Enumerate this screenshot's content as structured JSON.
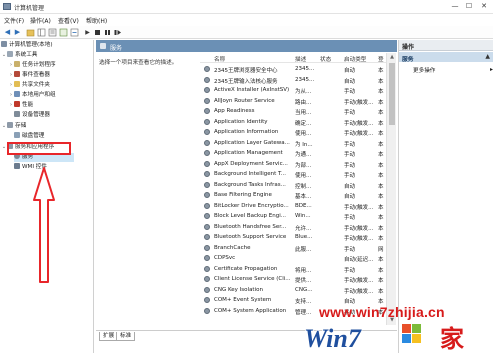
{
  "window": {
    "title": "计算机管理",
    "minimize": "—",
    "maximize": "☐",
    "close": "✕"
  },
  "menu": [
    "文件(F)",
    "操作(A)",
    "查看(V)",
    "帮助(H)"
  ],
  "tree": {
    "root": "计算机管理(本地)",
    "system_tools": "系统工具",
    "task_scheduler": "任务计划程序",
    "event_viewer": "事件查看器",
    "shared_folders": "共享文件夹",
    "local_users": "本地用户和组",
    "performance": "性能",
    "device_manager": "设备管理器",
    "storage": "存储",
    "disk_management": "磁盘管理",
    "services_apps": "服务和应用程序",
    "services": "服务",
    "wmi": "WMI 控件"
  },
  "services_pane": {
    "title": "服务",
    "description": "选择一个项目来查看它的描述。",
    "columns": [
      "名称",
      "描述",
      "状态",
      "启动类型",
      "登"
    ],
    "rows": [
      {
        "name": "2345王牌浏览器安全中心",
        "desc": "2345...",
        "status": "",
        "startup": "自动",
        "logon": "本"
      },
      {
        "name": "2345王牌输入法核心服务",
        "desc": "2345...",
        "status": "",
        "startup": "自动",
        "logon": "本"
      },
      {
        "name": "ActiveX Installer (AxInstSV)",
        "desc": "为从...",
        "status": "",
        "startup": "手动",
        "logon": "本"
      },
      {
        "name": "AllJoyn Router Service",
        "desc": "路由...",
        "status": "",
        "startup": "手动(触发...",
        "logon": "本"
      },
      {
        "name": "App Readiness",
        "desc": "当用...",
        "status": "",
        "startup": "手动",
        "logon": "本"
      },
      {
        "name": "Application Identity",
        "desc": "确定...",
        "status": "",
        "startup": "手动(触发...",
        "logon": "本"
      },
      {
        "name": "Application Information",
        "desc": "使用...",
        "status": "",
        "startup": "手动(触发...",
        "logon": "本"
      },
      {
        "name": "Application Layer Gatewa...",
        "desc": "为 In...",
        "status": "",
        "startup": "手动",
        "logon": "本"
      },
      {
        "name": "Application Management",
        "desc": "为通...",
        "status": "",
        "startup": "手动",
        "logon": "本"
      },
      {
        "name": "AppX Deployment Servic...",
        "desc": "为部...",
        "status": "",
        "startup": "手动",
        "logon": "本"
      },
      {
        "name": "Background Intelligent T...",
        "desc": "使用...",
        "status": "",
        "startup": "手动",
        "logon": "本"
      },
      {
        "name": "Background Tasks Infras...",
        "desc": "控制...",
        "status": "",
        "startup": "自动",
        "logon": "本"
      },
      {
        "name": "Base Filtering Engine",
        "desc": "基本...",
        "status": "",
        "startup": "自动",
        "logon": "本"
      },
      {
        "name": "BitLocker Drive Encryptio...",
        "desc": "BDE...",
        "status": "",
        "startup": "手动(触发...",
        "logon": "本"
      },
      {
        "name": "Block Level Backup Engi...",
        "desc": "Win...",
        "status": "",
        "startup": "手动",
        "logon": "本"
      },
      {
        "name": "Bluetooth Handsfree Ser...",
        "desc": "允许...",
        "status": "",
        "startup": "手动(触发...",
        "logon": "本"
      },
      {
        "name": "Bluetooth Support Service",
        "desc": "Blue...",
        "status": "",
        "startup": "手动(触发...",
        "logon": "本"
      },
      {
        "name": "BranchCache",
        "desc": "此服...",
        "status": "",
        "startup": "手动",
        "logon": "网"
      },
      {
        "name": "CDPSvc",
        "desc": "",
        "status": "",
        "startup": "自动(延迟...",
        "logon": "本"
      },
      {
        "name": "Certificate Propagation",
        "desc": "将用...",
        "status": "",
        "startup": "手动",
        "logon": "本"
      },
      {
        "name": "Client License Service (Cli...",
        "desc": "提供...",
        "status": "",
        "startup": "手动(触发...",
        "logon": "本"
      },
      {
        "name": "CNG Key Isolation",
        "desc": "CNG...",
        "status": "",
        "startup": "手动(触发...",
        "logon": "本"
      },
      {
        "name": "COM+ Event System",
        "desc": "支持...",
        "status": "",
        "startup": "自动",
        "logon": "本"
      },
      {
        "name": "COM+ System Application",
        "desc": "管理...",
        "status": "",
        "startup": "手动",
        "logon": "本"
      }
    ]
  },
  "tabs": [
    "扩展",
    "标准"
  ],
  "actions": {
    "header": "操作",
    "section": "服务",
    "more": "更多操作"
  },
  "watermark": {
    "url": "www.win7zhijia.cn",
    "logo_text": "Win7",
    "logo_suffix": "家"
  },
  "colors": {
    "pane_header": "#6b90b5",
    "selection": "#cde6f7",
    "annotation_red": "#e8262a"
  }
}
